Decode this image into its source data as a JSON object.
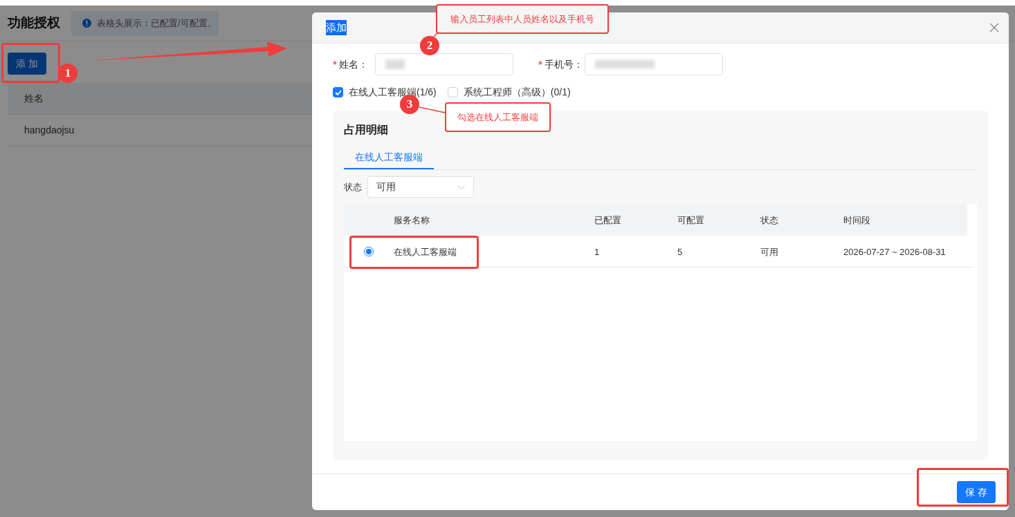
{
  "page": {
    "title": "功能授权",
    "notice": "表格头展示：已配置/可配置。",
    "add_button": "添 加",
    "table": {
      "columns": [
        "姓名"
      ],
      "rows": [
        [
          "hangdaojsu"
        ]
      ]
    }
  },
  "dialog": {
    "title": "添加",
    "title_selected": true,
    "fields": [
      {
        "label": "姓名：",
        "required": true
      },
      {
        "label": "手机号：",
        "required": true
      }
    ],
    "services": [
      {
        "label": "在线人工客服端(1/6)",
        "checked": true
      },
      {
        "label": "系统工程师（高级）(0/1)",
        "checked": false
      }
    ],
    "detail": {
      "title": "占用明细",
      "tabs": [
        {
          "label": "在线人工客服端",
          "selected": true
        }
      ],
      "filter": {
        "label": "状态",
        "value": "可用"
      },
      "table": {
        "columns": [
          "服务名称",
          "已配置",
          "可配置",
          "状态",
          "时间段"
        ],
        "rows": [
          {
            "selected": true,
            "cells": [
              "在线人工客服端",
              "1",
              "5",
              "可用",
              "2026-07-27 ~ 2026-08-31"
            ]
          }
        ]
      }
    },
    "save_button": "保 存"
  },
  "annotations": [
    {
      "number": "1"
    },
    {
      "number": "2",
      "text": "输入员工列表中人员姓名以及手机号"
    },
    {
      "number": "3",
      "text": "勾选在线人工客服端"
    }
  ]
}
